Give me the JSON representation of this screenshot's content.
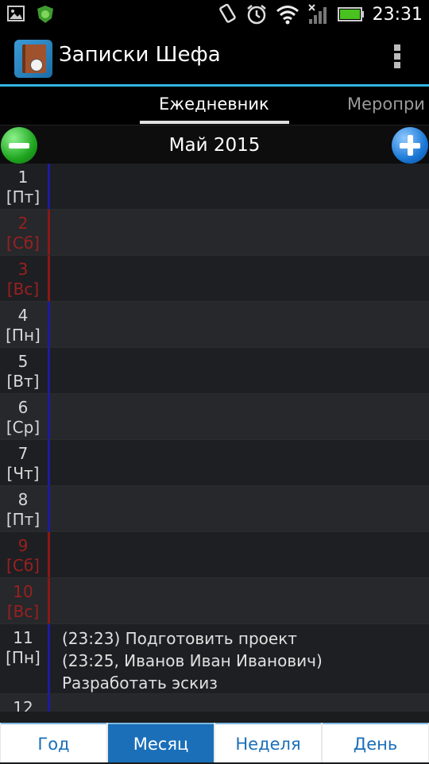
{
  "status_bar": {
    "time": "23:31",
    "icons": [
      "image-icon",
      "shield-icon",
      "vibrate-icon",
      "alarm-icon",
      "wifi-icon",
      "signal-icon",
      "battery-icon"
    ]
  },
  "app": {
    "title": "Записки Шефа"
  },
  "tabs": [
    {
      "label": "Ежедневник",
      "selected": true
    },
    {
      "label": "Меропри",
      "selected": false
    }
  ],
  "month": {
    "title": "Май 2015"
  },
  "days": [
    {
      "num": "1",
      "dow": "[Пт]",
      "weekend": false,
      "events": []
    },
    {
      "num": "2",
      "dow": "[Сб]",
      "weekend": true,
      "events": []
    },
    {
      "num": "3",
      "dow": "[Вс]",
      "weekend": true,
      "events": []
    },
    {
      "num": "4",
      "dow": "[Пн]",
      "weekend": false,
      "events": []
    },
    {
      "num": "5",
      "dow": "[Вт]",
      "weekend": false,
      "events": []
    },
    {
      "num": "6",
      "dow": "[Ср]",
      "weekend": false,
      "events": []
    },
    {
      "num": "7",
      "dow": "[Чт]",
      "weekend": false,
      "events": []
    },
    {
      "num": "8",
      "dow": "[Пт]",
      "weekend": false,
      "events": []
    },
    {
      "num": "9",
      "dow": "[Сб]",
      "weekend": true,
      "events": []
    },
    {
      "num": "10",
      "dow": "[Вс]",
      "weekend": true,
      "events": []
    },
    {
      "num": "11",
      "dow": "[Пн]",
      "weekend": false,
      "events": [
        "(23:23) Подготовить проект",
        "(23:25, Иванов Иван Иванович)",
        "Разработать эскиз"
      ]
    },
    {
      "num": "12",
      "dow": "",
      "weekend": false,
      "events": []
    }
  ],
  "bottom_tabs": [
    {
      "label": "Год",
      "active": false
    },
    {
      "label": "Месяц",
      "active": true
    },
    {
      "label": "Неделя",
      "active": false
    },
    {
      "label": "День",
      "active": false
    }
  ],
  "colors": {
    "accent": "#33b5e5",
    "weekday_bar": "#1c1ca0",
    "weekend_red": "#9a2020",
    "bottom_active": "#1b6fb8"
  }
}
